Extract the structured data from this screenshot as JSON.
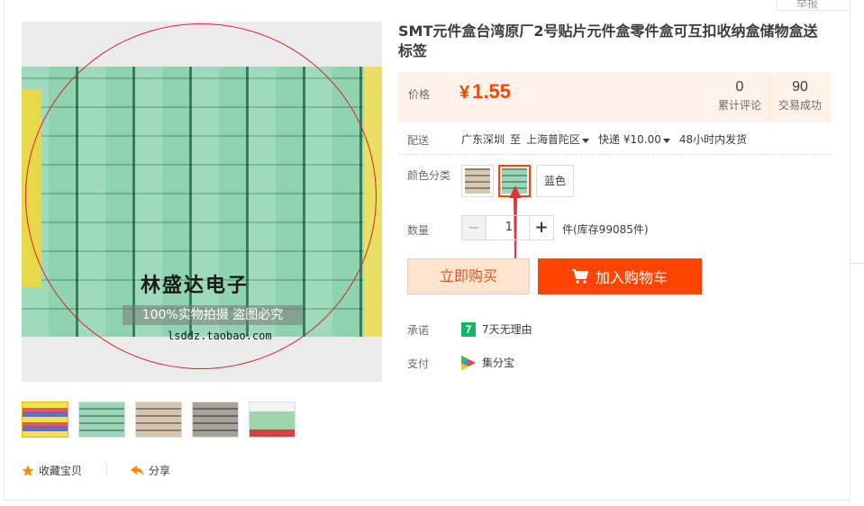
{
  "header": {
    "report_label": "举报"
  },
  "gallery": {
    "watermark_title": "林盛达电子",
    "watermark_slogan": "100%实物拍摄  盗图必究",
    "watermark_url": "lsddz.taobao.com",
    "thumbnails": [
      "thumb-1",
      "thumb-2",
      "thumb-3",
      "thumb-4",
      "thumb-5"
    ]
  },
  "actions": {
    "favorite_label": "收藏宝贝",
    "share_label": "分享"
  },
  "product": {
    "title": "SMT元件盒台湾原厂2号贴片元件盒零件盒可互扣收纳盒储物盒送标签"
  },
  "price": {
    "label": "价格",
    "currency": "¥",
    "value": "1.55",
    "reviews_count": "0",
    "reviews_label": "累计评论",
    "sales_count": "90",
    "sales_label": "交易成功"
  },
  "shipping": {
    "label": "配送",
    "from": "广东深圳",
    "to_word": "至",
    "to": "上海普陀区",
    "method": "快递 ¥10.00",
    "dispatch": "48小时内发货"
  },
  "color": {
    "label": "颜色分类",
    "option_text": "蓝色"
  },
  "quantity": {
    "label": "数量",
    "value": "1",
    "minus": "−",
    "plus": "+",
    "stock": "件(库存99085件)"
  },
  "buttons": {
    "buy_now": "立即购买",
    "add_to_cart": "加入购物车"
  },
  "promise": {
    "label": "承诺",
    "badge": "7",
    "text": "7天无理由"
  },
  "payment": {
    "label": "支付",
    "text": "集分宝"
  },
  "colors": {
    "accent": "#ff4400",
    "price_bg": "#fff2e8",
    "buy_bg": "#ffe4d0",
    "promise_badge": "#19b26b"
  }
}
